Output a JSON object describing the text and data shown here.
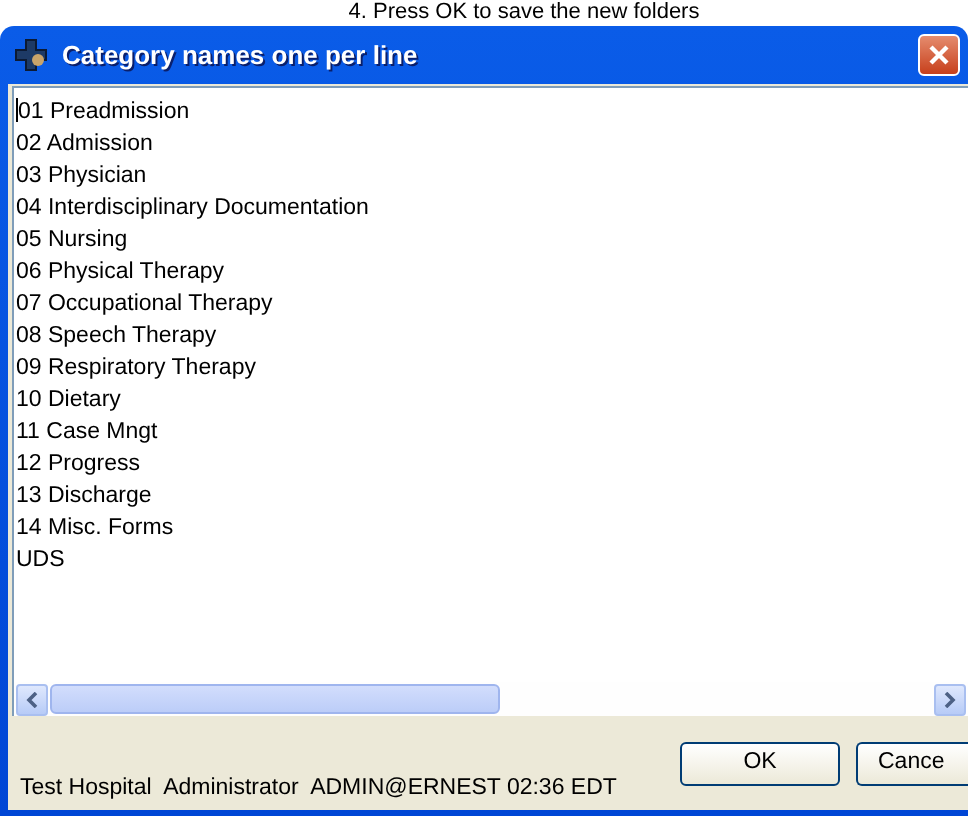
{
  "instruction": "4. Press OK to save the new folders",
  "window": {
    "title": "Category names one per line"
  },
  "category_lines": [
    "01 Preadmission",
    "02 Admission",
    "03 Physician",
    "04 Interdisciplinary Documentation",
    "05 Nursing",
    "06 Physical Therapy",
    "07 Occupational Therapy",
    "08 Speech Therapy",
    "09 Respiratory Therapy",
    "10 Dietary",
    "11 Case Mngt",
    "12 Progress",
    "13 Discharge",
    "14 Misc. Forms",
    "UDS"
  ],
  "status_bar": "Test Hospital  Administrator  ADMIN@ERNEST 02:36 EDT",
  "buttons": [
    "OK",
    "Cance"
  ]
}
